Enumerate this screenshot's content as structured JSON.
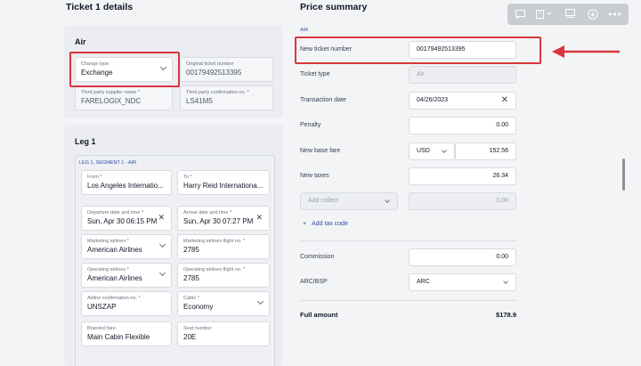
{
  "left": {
    "title": "Ticket 1 details",
    "air": {
      "title": "Air",
      "change_type": {
        "label": "Change type",
        "value": "Exchange"
      },
      "original_ticket": {
        "label": "Original ticket number",
        "value": "00179492513395"
      },
      "supplier_name": {
        "label": "Third party supplier name *",
        "value": "FARELOGIX_NDC"
      },
      "confirmation": {
        "label": "Third party confirmation no. *",
        "value": "LS41M5"
      }
    },
    "leg": {
      "title": "Leg 1",
      "segment_label": "LEG 1, SEGMENT 1 - AIR",
      "from": {
        "label": "From *",
        "value": "Los Angeles Internatio..."
      },
      "to": {
        "label": "To *",
        "value": "Harry Reid Internationa..."
      },
      "departure": {
        "label": "Departure date and time *",
        "value": "Sun, Apr 30 06:15 PM"
      },
      "arrival": {
        "label": "Arrival date and time *",
        "value": "Sun, Apr 30 07:27 PM"
      },
      "marketing_airline": {
        "label": "Marketing airlines *",
        "value": "American Airlines"
      },
      "marketing_flight": {
        "label": "Marketing airlines flight no. *",
        "value": "2785"
      },
      "operating_airline": {
        "label": "Operating airlines *",
        "value": "American Airlines"
      },
      "operating_flight": {
        "label": "Operating airlines flight no. *",
        "value": "2785"
      },
      "airline_confirmation": {
        "label": "Airline confirmation no. *",
        "value": "UNSZAP"
      },
      "cabin": {
        "label": "Cabin *",
        "value": "Economy"
      },
      "branded_fare": {
        "label": "Branded fare",
        "value": "Main Cabin Flexible"
      },
      "seat": {
        "label": "Seat number",
        "value": "20E"
      }
    }
  },
  "right": {
    "title": "Price summary",
    "section_tag": "AIR",
    "new_ticket": {
      "label": "New ticket number",
      "value": "00179492513395"
    },
    "ticket_type": {
      "label": "Ticket type",
      "value": "Air"
    },
    "transaction_date": {
      "label": "Transaction date",
      "value": "04/26/2023"
    },
    "penalty": {
      "label": "Penalty",
      "value": "0.00"
    },
    "base_fare": {
      "label": "New base fare",
      "currency": "USD",
      "value": "152.56"
    },
    "taxes": {
      "label": "New taxes",
      "value": "26.34"
    },
    "add_collect": {
      "placeholder": "Add collect",
      "value": "0.00"
    },
    "add_tax_code": "Add tax code",
    "commission": {
      "label": "Commission",
      "value": "0.00"
    },
    "arc_bsp": {
      "label": "ARC/BSP",
      "value": "ARC"
    },
    "full_amount": {
      "label": "Full amount",
      "value": "$178.9"
    }
  },
  "colors": {
    "highlight": "#d9363e",
    "accent": "#2d4fa3"
  },
  "icons": [
    "comment-icon",
    "layout-icon",
    "panel-icon",
    "download-icon",
    "more-icon",
    "arrow-annotation-icon"
  ]
}
